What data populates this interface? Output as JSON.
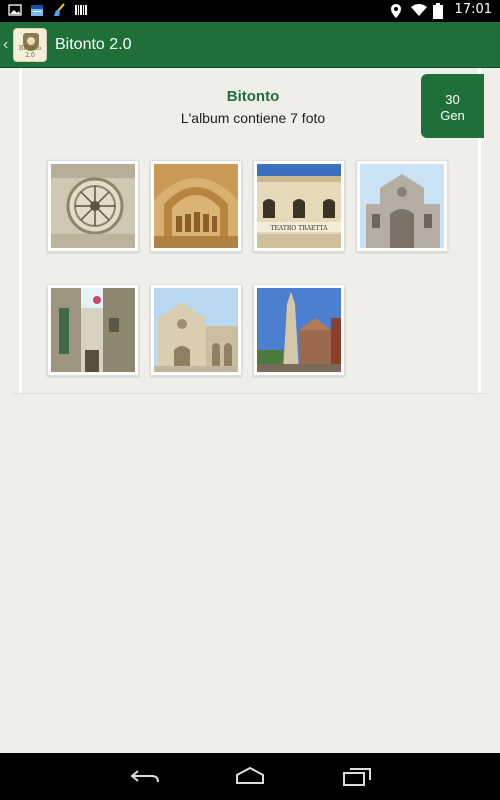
{
  "status_bar": {
    "time": "17:01",
    "icons_left": [
      "image-icon",
      "calendar-icon",
      "broom-icon",
      "barcode-icon"
    ],
    "icons_right": [
      "location-icon",
      "wifi-icon",
      "battery-icon"
    ]
  },
  "action_bar": {
    "title": "Bitonto 2.0",
    "logo_text": "Bitonto 2.0",
    "color": "#1f6f3a"
  },
  "album": {
    "title": "Bitonto",
    "subtitle": "L'album contiene 7 foto",
    "date_day": "30",
    "date_month": "Gen"
  },
  "photos": [
    {
      "name": "rose-window"
    },
    {
      "name": "portal-relief"
    },
    {
      "name": "teatro-traetta"
    },
    {
      "name": "baroque-church"
    },
    {
      "name": "narrow-street"
    },
    {
      "name": "cathedral"
    },
    {
      "name": "obelisk"
    }
  ],
  "nav_bar": {
    "icons": [
      "back-icon",
      "home-icon",
      "recent-apps-icon"
    ]
  }
}
